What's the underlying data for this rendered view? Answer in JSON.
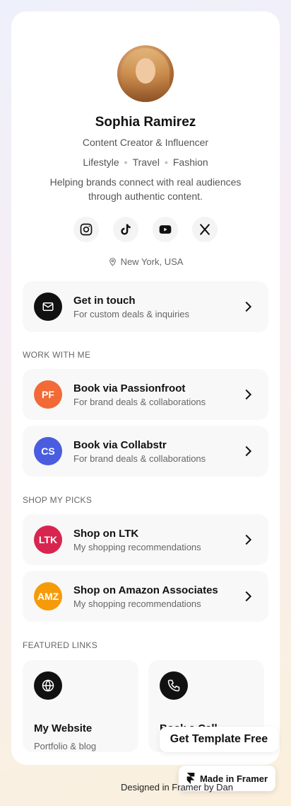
{
  "profile": {
    "name": "Sophia Ramirez",
    "role": "Content Creator & Influencer",
    "tags": [
      "Lifestyle",
      "Travel",
      "Fashion"
    ],
    "bio_line1": "Helping brands connect with real audiences",
    "bio_line2": "through authentic content.",
    "location": "New York, USA"
  },
  "socials": [
    {
      "icon": "instagram-icon"
    },
    {
      "icon": "tiktok-icon"
    },
    {
      "icon": "youtube-icon"
    },
    {
      "icon": "x-icon"
    }
  ],
  "contact": {
    "title": "Get in touch",
    "subtitle": "For custom deals & inquiries",
    "icon": "mail-icon"
  },
  "work": {
    "heading": "WORK WITH ME",
    "items": [
      {
        "badge": "PF",
        "title": "Book via Passionfroot",
        "subtitle": "For brand deals & collaborations",
        "color": "#f26a35"
      },
      {
        "badge": "CS",
        "title": "Book via Collabstr",
        "subtitle": "For brand deals & collaborations",
        "color": "#4a5de0"
      }
    ]
  },
  "shop": {
    "heading": "SHOP MY PICKS",
    "items": [
      {
        "badge": "LTK",
        "title": "Shop on LTK",
        "subtitle": "My shopping recommendations",
        "color": "#d8254f"
      },
      {
        "badge": "AMZ",
        "title": "Shop on Amazon Associates",
        "subtitle": "My shopping recommendations",
        "color": "#f59b0a"
      }
    ]
  },
  "featured": {
    "heading": "FEATURED LINKS",
    "items": [
      {
        "title": "My Website",
        "subtitle": "Portfolio & blog",
        "icon": "globe-icon"
      },
      {
        "title": "Book a Call",
        "subtitle": "",
        "icon": "phone-icon"
      }
    ]
  },
  "template_button": "Get Template Free",
  "footer_text": "Designed in Framer by Dan",
  "framer_badge": "Made in Framer"
}
